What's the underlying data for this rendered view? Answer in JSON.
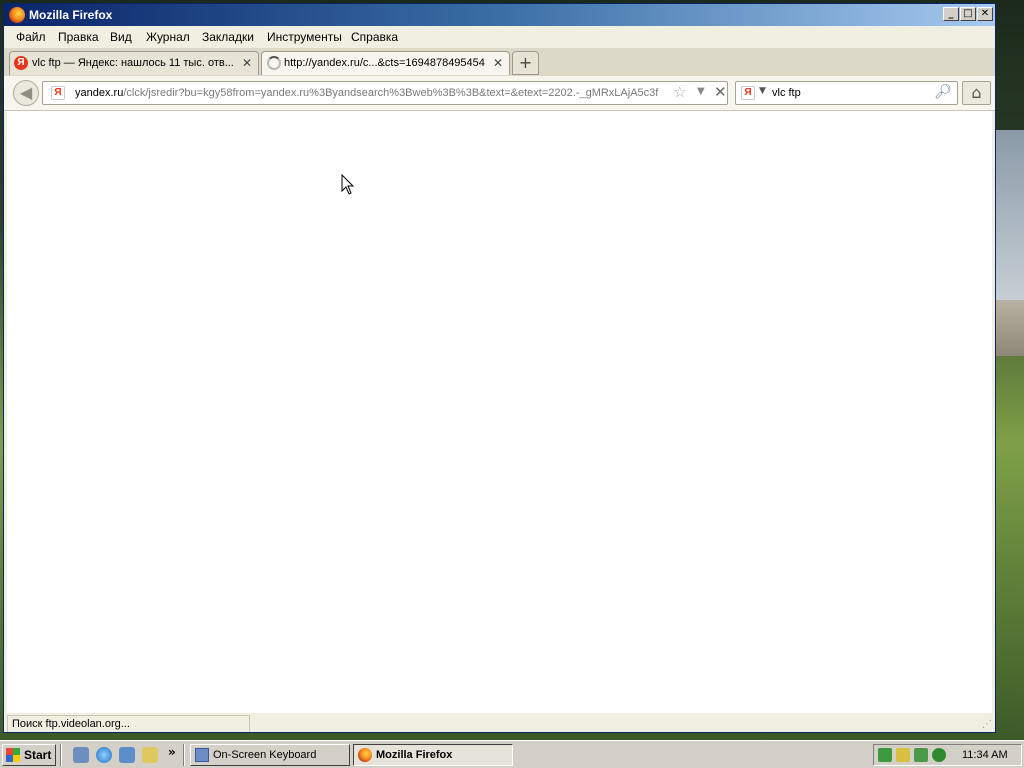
{
  "window": {
    "title": "Mozilla Firefox",
    "controls": {
      "minimize": "_",
      "maximize": "□",
      "close": "✕"
    }
  },
  "menu": [
    "Файл",
    "Правка",
    "Вид",
    "Журнал",
    "Закладки",
    "Инструменты",
    "Справка"
  ],
  "tabs": [
    {
      "label": "vlc ftp — Яндекс: нашлось 11 тыс. отв...",
      "icon": "yandex-icon",
      "selected": false
    },
    {
      "label": "http://yandex.ru/c...&cts=1694878495454",
      "icon": "loading-spinner-icon",
      "selected": true
    }
  ],
  "newtab_label": "+",
  "navbar": {
    "url_domain": "yandex.ru",
    "url_rest": "/clck/jsredir?bu=kgy58from=yandex.ru%3Byandsearch%3Bweb%3B%3B&text=&etext=2202.-_gMRxLAjA5c3f",
    "search_engine_letter": "Я",
    "search_value": "vlc ftp"
  },
  "status": {
    "text": "Поиск ftp.videolan.org..."
  },
  "taskbar": {
    "start_label": "Start",
    "overflow": "»",
    "buttons": [
      {
        "label": "On-Screen Keyboard",
        "active": false
      },
      {
        "label": "Mozilla Firefox",
        "active": true
      }
    ],
    "clock": "11:34 AM"
  },
  "colors": {
    "titlebar_start": "#0a246a",
    "titlebar_end": "#a6caf0",
    "yandex_red": "#e8341c"
  }
}
